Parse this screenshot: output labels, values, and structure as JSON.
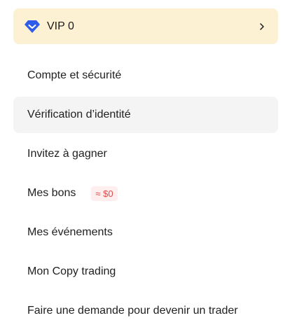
{
  "vip": {
    "label": "VIP 0",
    "icon": "diamond-icon",
    "chevron": "›",
    "icon_color": "#2f5bea"
  },
  "menu": {
    "items": [
      {
        "label": "Compte et sécurité"
      },
      {
        "label": "Vérification d’identité",
        "active": true
      },
      {
        "label": "Invitez à gagner"
      },
      {
        "label": "Mes bons",
        "badge": "≈ $0"
      },
      {
        "label": "Mes événements"
      },
      {
        "label": "Mon Copy trading"
      },
      {
        "label": "Faire une demande pour devenir un trader"
      }
    ]
  },
  "colors": {
    "vip_bg": "#fdf1d3",
    "active_bg": "#f4f4f5",
    "badge_text": "#e5484d",
    "badge_bg": "#feeeee"
  }
}
